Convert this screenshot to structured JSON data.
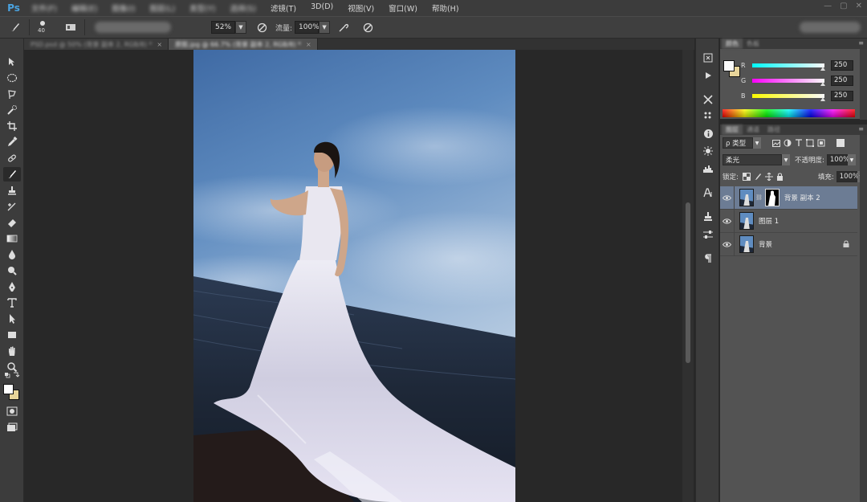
{
  "app": {
    "logo": "Ps"
  },
  "menu": {
    "items": [
      {
        "label": "文件(F)",
        "blurred": true
      },
      {
        "label": "编辑(E)",
        "blurred": true
      },
      {
        "label": "图像(I)",
        "blurred": true
      },
      {
        "label": "图层(L)",
        "blurred": true
      },
      {
        "label": "类型(Y)",
        "blurred": true
      },
      {
        "label": "选择(S)",
        "blurred": true
      },
      {
        "label": "滤镜(T)",
        "blurred": false
      },
      {
        "label": "3D(D)",
        "blurred": false
      },
      {
        "label": "视图(V)",
        "blurred": false
      },
      {
        "label": "窗口(W)",
        "blurred": false
      },
      {
        "label": "帮助(H)",
        "blurred": false
      }
    ],
    "window_controls": [
      "—",
      "▢",
      "✕"
    ]
  },
  "options": {
    "brush_size": "40",
    "opacity_value": "52%",
    "flow_label": "流量:",
    "flow_value": "100%"
  },
  "tabs": [
    {
      "label": "PSD.psd @ 50% (背景 副本 2, RGB/8) *",
      "active": false
    },
    {
      "label": "原图.jpg @ 66.7% (背景 副本 2, RGB/8) *",
      "active": true
    }
  ],
  "color_panel": {
    "tabs": [
      "颜色",
      "色板"
    ],
    "rows": [
      {
        "channel": "R",
        "value": "250",
        "knob_fraction": 0.98,
        "gradient": "linear-gradient(to right,#00fafa,#fafafa)"
      },
      {
        "channel": "G",
        "value": "250",
        "knob_fraction": 0.98,
        "gradient": "linear-gradient(to right,#fa00fa,#fafafa)"
      },
      {
        "channel": "B",
        "value": "250",
        "knob_fraction": 0.98,
        "gradient": "linear-gradient(to right,#fafa00,#fafafa)"
      }
    ],
    "foreground": "#fafafa",
    "background": "#e8d59a"
  },
  "layers_panel": {
    "tabs": [
      "图层",
      "通道",
      "路径"
    ],
    "filter_kind": "ρ 类型",
    "blend_mode": "柔光",
    "opacity_label": "不透明度:",
    "opacity_value": "100%",
    "lock_label": "锁定:",
    "fill_label": "填充:",
    "fill_value": "100%",
    "layers": [
      {
        "name": "背景 副本 2",
        "selected": true,
        "has_mask": true,
        "locked": false
      },
      {
        "name": "图层 1",
        "selected": false,
        "has_mask": false,
        "locked": false
      },
      {
        "name": "背景",
        "selected": false,
        "has_mask": false,
        "locked": true
      }
    ]
  }
}
